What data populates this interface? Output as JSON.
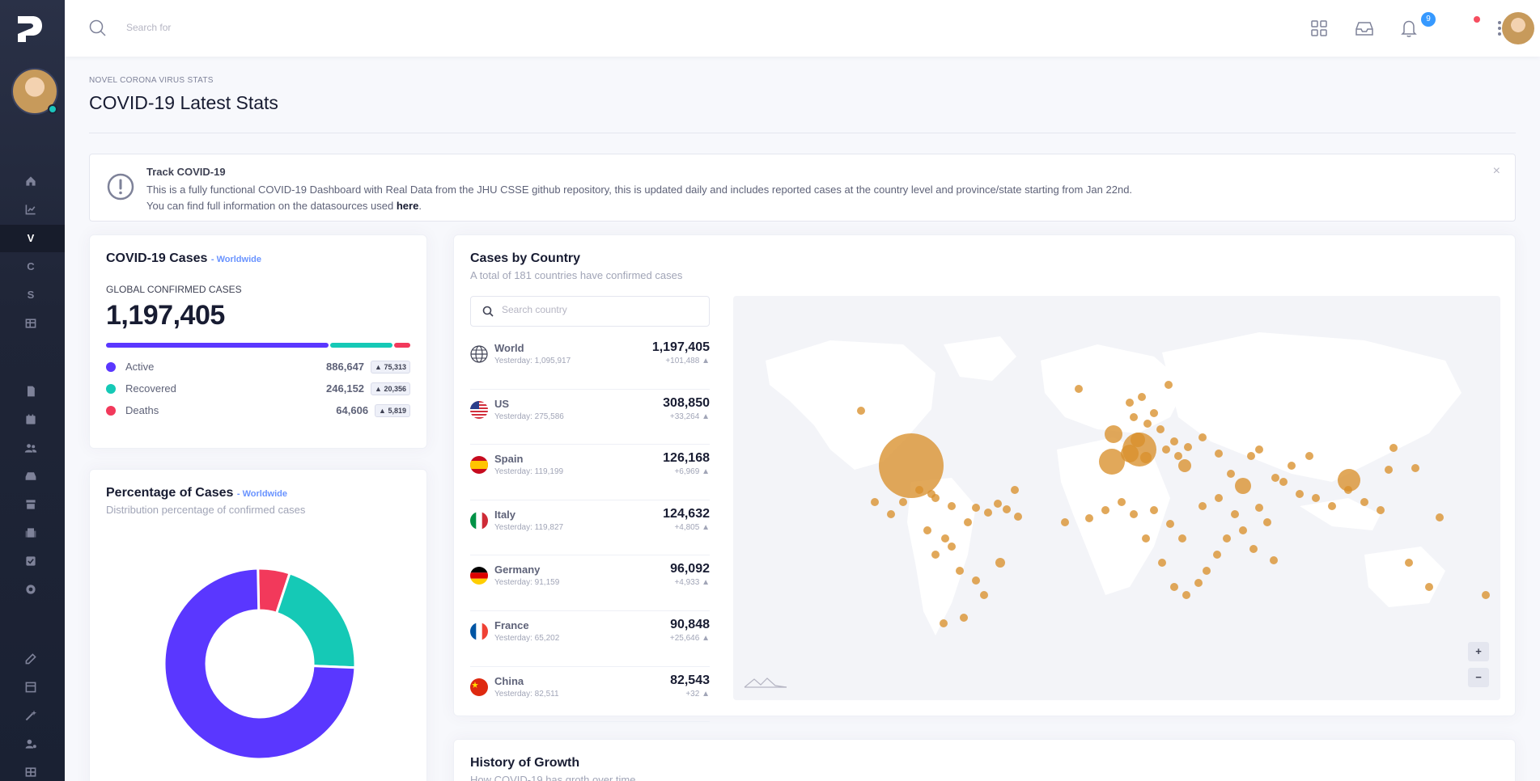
{
  "app": {
    "logo": "P",
    "search_placeholder": "Search for",
    "inbox_badge": "9"
  },
  "sidebar": {
    "items": [
      {
        "icon": "home-icon"
      },
      {
        "icon": "chart-icon"
      },
      {
        "letter": "V",
        "active": true
      },
      {
        "letter": "C"
      },
      {
        "letter": "S"
      },
      {
        "icon": "table-icon"
      },
      {
        "icon": "document-icon"
      },
      {
        "icon": "calendar-icon"
      },
      {
        "icon": "users-icon"
      },
      {
        "icon": "inbox-icon"
      },
      {
        "icon": "store-icon"
      },
      {
        "icon": "building-icon"
      },
      {
        "icon": "check-square-icon"
      },
      {
        "icon": "support-icon"
      },
      {
        "icon": "edit-icon"
      },
      {
        "icon": "layout-icon"
      },
      {
        "icon": "magic-icon"
      },
      {
        "icon": "user-settings-icon"
      },
      {
        "icon": "grid-icon"
      }
    ]
  },
  "page": {
    "breadcrumb": "NOVEL CORONA VIRUS STATS",
    "title": "COVID-19 Latest Stats"
  },
  "alert": {
    "title": "Track COVID-19",
    "line1": "This is a fully functional COVID-19 Dashboard with Real Data from the JHU CSSE github repository, this is updated daily and includes reported cases at the country level and province/state starting from Jan 22nd.",
    "line2_prefix": "You can find full information on the datasources used",
    "line2_link": "here",
    "line2_suffix": "."
  },
  "cases_card": {
    "title": "COVID-19 Cases",
    "subtitle": "- Worldwide",
    "label": "GLOBAL CONFIRMED CASES",
    "total": "1,197,405",
    "stats": [
      {
        "name": "Active",
        "value": "886,647",
        "badge": "75,313",
        "color": "#5a37ff",
        "share": 0.7405
      },
      {
        "name": "Recovered",
        "value": "246,152",
        "badge": "20,356",
        "color": "#15c9b6",
        "share": 0.2056
      },
      {
        "name": "Deaths",
        "value": "64,606",
        "badge": "5,819",
        "color": "#f2395b",
        "share": 0.054
      }
    ]
  },
  "percentage_card": {
    "title": "Percentage of Cases",
    "subtitle": "- Worldwide",
    "description": "Distribution percentage of confirmed cases"
  },
  "country_card": {
    "title": "Cases by Country",
    "description": "A total of 181 countries have confirmed cases",
    "search_placeholder": "Search country",
    "countries": [
      {
        "name": "World",
        "yesterday": "Yesterday: 1,095,917",
        "total": "1,197,405",
        "delta": "+101,488",
        "flag": "globe"
      },
      {
        "name": "US",
        "yesterday": "Yesterday: 275,586",
        "total": "308,850",
        "delta": "+33,264",
        "flag": "us"
      },
      {
        "name": "Spain",
        "yesterday": "Yesterday: 119,199",
        "total": "126,168",
        "delta": "+6,969",
        "flag": "es"
      },
      {
        "name": "Italy",
        "yesterday": "Yesterday: 119,827",
        "total": "124,632",
        "delta": "+4,805",
        "flag": "it"
      },
      {
        "name": "Germany",
        "yesterday": "Yesterday: 91,159",
        "total": "96,092",
        "delta": "+4,933",
        "flag": "de"
      },
      {
        "name": "France",
        "yesterday": "Yesterday: 65,202",
        "total": "90,848",
        "delta": "+25,646",
        "flag": "fr"
      },
      {
        "name": "China",
        "yesterday": "Yesterday: 82,511",
        "total": "82,543",
        "delta": "+32",
        "flag": "cn"
      }
    ],
    "map": {
      "zoom_in": "+",
      "zoom_out": "−",
      "bubble_color": "#d98f2b"
    }
  },
  "growth_card": {
    "title": "History of Growth",
    "description": "How COVID-19 has groth over time"
  }
}
